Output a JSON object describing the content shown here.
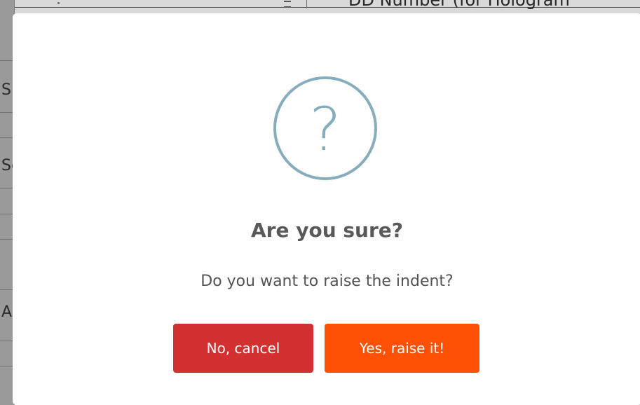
{
  "background": {
    "header_text": "DD Number (for Hologram",
    "left_letters": [
      "Si",
      "Se",
      "A"
    ]
  },
  "dialog": {
    "icon": "question-icon",
    "icon_glyph": "?",
    "icon_color": "#87adbd",
    "title": "Are you sure?",
    "text": "Do you want to raise the indent?",
    "cancel_label": "No, cancel",
    "confirm_label": "Yes, raise it!",
    "cancel_color": "#d33131",
    "confirm_color": "#ff5106"
  }
}
